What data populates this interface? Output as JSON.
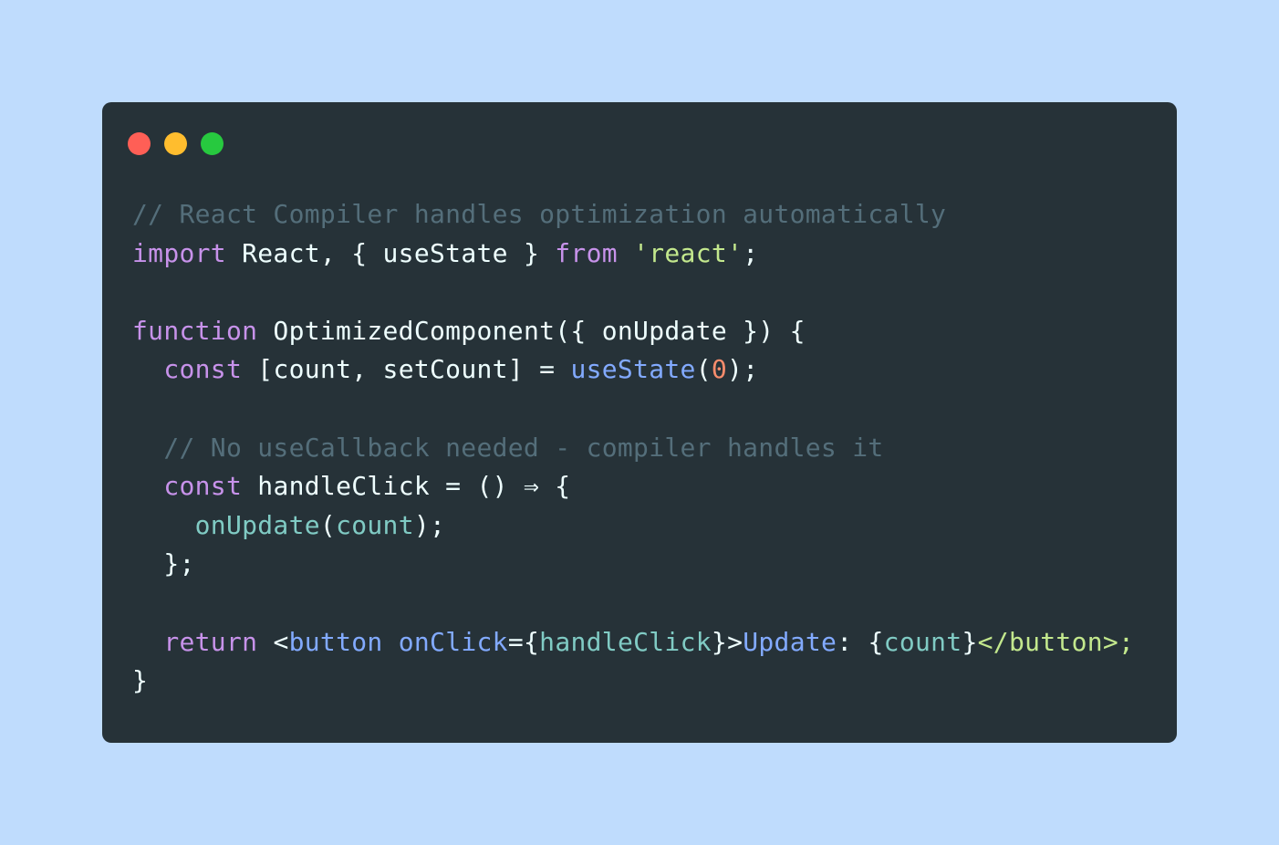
{
  "window": {
    "controls": [
      {
        "name": "close",
        "color": "#ff5f56"
      },
      {
        "name": "minimize",
        "color": "#ffbd2e"
      },
      {
        "name": "zoom",
        "color": "#27c93f"
      }
    ]
  },
  "code": {
    "lines": [
      [
        {
          "t": "// React Compiler handles optimization automatically",
          "k": "comment"
        }
      ],
      [
        {
          "t": "import",
          "k": "kw"
        },
        {
          "t": " React, { useState } ",
          "k": "plain"
        },
        {
          "t": "from",
          "k": "kw"
        },
        {
          "t": " ",
          "k": "plain"
        },
        {
          "t": "'react'",
          "k": "str"
        },
        {
          "t": ";",
          "k": "plain"
        }
      ],
      [],
      [
        {
          "t": "function",
          "k": "kw"
        },
        {
          "t": " OptimizedComponent({ onUpdate }) {",
          "k": "plain"
        }
      ],
      [
        {
          "t": "  ",
          "k": "plain"
        },
        {
          "t": "const",
          "k": "kw"
        },
        {
          "t": " [count, setCount] = ",
          "k": "plain"
        },
        {
          "t": "useState",
          "k": "fn"
        },
        {
          "t": "(",
          "k": "plain"
        },
        {
          "t": "0",
          "k": "num"
        },
        {
          "t": ");",
          "k": "plain"
        }
      ],
      [],
      [
        {
          "t": "  // No useCallback needed - compiler handles it",
          "k": "comment"
        }
      ],
      [
        {
          "t": "  ",
          "k": "plain"
        },
        {
          "t": "const",
          "k": "kw"
        },
        {
          "t": " handleClick = () ⇒ {",
          "k": "plain"
        }
      ],
      [
        {
          "t": "    ",
          "k": "plain"
        },
        {
          "t": "onUpdate",
          "k": "var"
        },
        {
          "t": "(",
          "k": "plain"
        },
        {
          "t": "count",
          "k": "var"
        },
        {
          "t": ");",
          "k": "plain"
        }
      ],
      [
        {
          "t": "  };",
          "k": "plain"
        }
      ],
      [],
      [
        {
          "t": "  ",
          "k": "plain"
        },
        {
          "t": "return",
          "k": "kw"
        },
        {
          "t": " <",
          "k": "plain"
        },
        {
          "t": "button",
          "k": "fn"
        },
        {
          "t": " ",
          "k": "plain"
        },
        {
          "t": "onClick",
          "k": "fn"
        },
        {
          "t": "={",
          "k": "plain"
        },
        {
          "t": "handleClick",
          "k": "var"
        },
        {
          "t": "}>",
          "k": "plain"
        },
        {
          "t": "Update",
          "k": "fn"
        },
        {
          "t": ": {",
          "k": "plain"
        },
        {
          "t": "count",
          "k": "var"
        },
        {
          "t": "}",
          "k": "plain"
        },
        {
          "t": "</button>;",
          "k": "str"
        }
      ],
      [
        {
          "t": "}",
          "k": "plain"
        }
      ]
    ]
  }
}
